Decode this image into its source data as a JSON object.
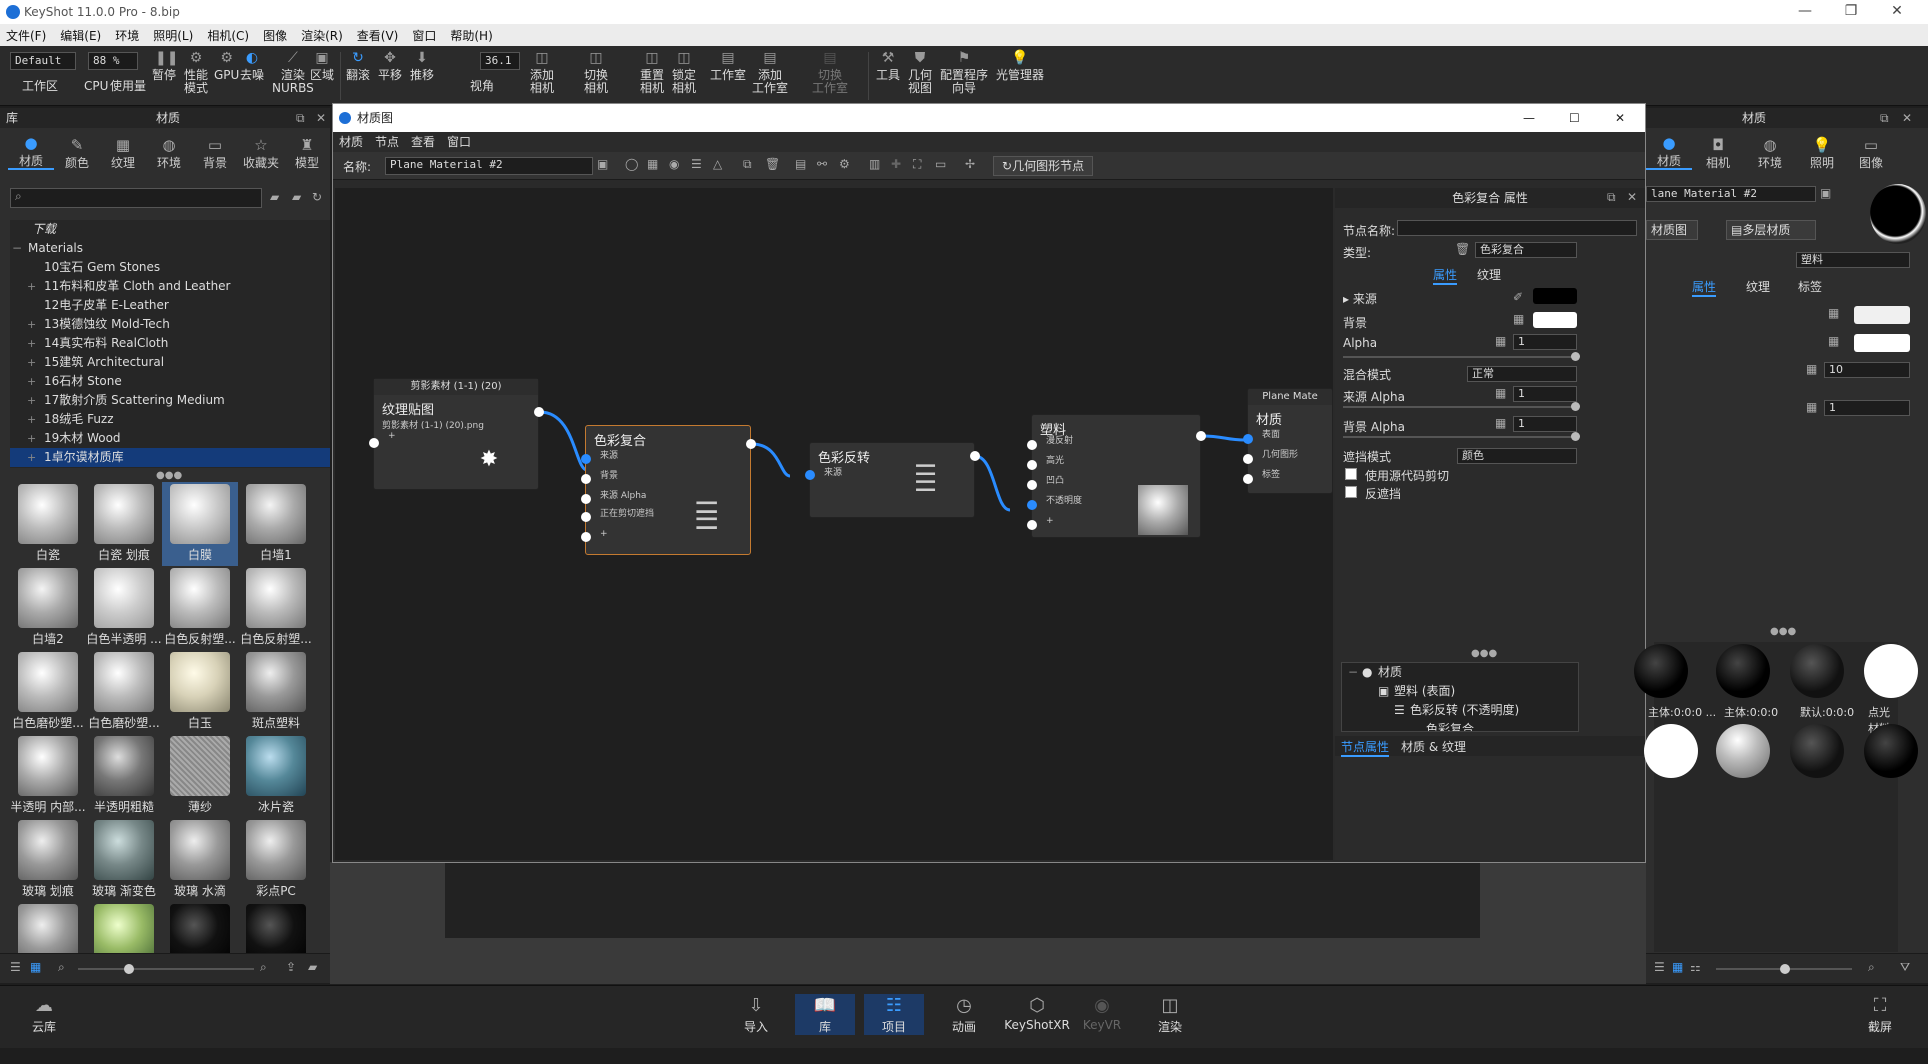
{
  "app": {
    "title": "KeyShot 11.0.0 Pro  - 8.bip",
    "minimize": "—",
    "maximize": "❐",
    "close": "✕"
  },
  "menu": [
    "文件(F)",
    "编辑(E)",
    "环境",
    "照明(L)",
    "相机(C)",
    "图像",
    "渲染(R)",
    "查看(V)",
    "窗口",
    "帮助(H)"
  ],
  "toolbar": {
    "workspace_select": "Default",
    "zoom_select": "88 %",
    "fov_value": "36.1",
    "items": [
      {
        "label": "工作区",
        "icon": "layout-icon"
      },
      {
        "label": "CPU",
        "icon": "cpu-icon"
      },
      {
        "label": "使用量",
        "icon": "usage-icon"
      },
      {
        "label": "暂停",
        "icon": "pause-icon"
      },
      {
        "label": "性能\n模式",
        "icon": "performance-icon"
      },
      {
        "label": "GPU",
        "icon": "gpu-icon"
      },
      {
        "label": "去噪",
        "icon": "denoise-icon"
      },
      {
        "label": "渲染\nNURBS",
        "icon": "nurbs-icon"
      },
      {
        "label": "区域",
        "icon": "region-icon"
      },
      {
        "label": "翻滚",
        "icon": "tumble-icon"
      },
      {
        "label": "平移",
        "icon": "pan-icon"
      },
      {
        "label": "推移",
        "icon": "dolly-icon"
      },
      {
        "label": "视角",
        "icon": "fov-icon"
      },
      {
        "label": "添加\n相机",
        "icon": "add-camera-icon"
      },
      {
        "label": "切换\n相机",
        "icon": "switch-camera-icon"
      },
      {
        "label": "重置\n相机",
        "icon": "reset-camera-icon"
      },
      {
        "label": "锁定\n相机",
        "icon": "lock-camera-icon"
      },
      {
        "label": "工作室",
        "icon": "studio-icon"
      },
      {
        "label": "添加\n工作室",
        "icon": "add-studio-icon"
      },
      {
        "label": "切换\n工作室",
        "icon": "switch-studio-icon"
      },
      {
        "label": "工具",
        "icon": "tools-icon"
      },
      {
        "label": "几何\n视图",
        "icon": "geometry-view-icon"
      },
      {
        "label": "配置程序\n向导",
        "icon": "configurator-icon"
      },
      {
        "label": "光管理器",
        "icon": "light-manager-icon"
      }
    ]
  },
  "library": {
    "header_left": "库",
    "header": "材质",
    "tabs": [
      "材质",
      "颜色",
      "纹理",
      "环境",
      "背景",
      "收藏夹",
      "模型"
    ],
    "tree": [
      "下载",
      "Materials",
      "10宝石 Gem Stones",
      "11布料和皮革 Cloth and Leather",
      "12电子皮革 E-Leather",
      "13模德蚀纹 Mold-Tech",
      "14真实布料 RealCloth",
      "15建筑 Architectural",
      "16石材 Stone",
      "17散射介质 Scattering Medium",
      "18绒毛 Fuzz",
      "19木材 Wood",
      "1卓尔谟材质库"
    ],
    "thumbs": [
      "白瓷",
      "白瓷 划痕",
      "白膜",
      "白墙1",
      "白墙2",
      "白色半透明 ...",
      "白色反射塑...",
      "白色反射塑...",
      "白色磨砂塑...",
      "白色磨砂塑...",
      "白玉",
      "斑点塑料",
      "半透明 内部...",
      "半透明粗糙",
      "薄纱",
      "冰片瓷",
      "玻璃 划痕",
      "玻璃 渐变色",
      "玻璃 水滴",
      "彩点PC",
      "",
      "",
      "",
      ""
    ]
  },
  "graph": {
    "title": "材质图",
    "menu": [
      "材质",
      "节点",
      "查看",
      "窗口"
    ],
    "name_label": "名称:",
    "name_value": "Plane Material  #2",
    "geom_button": "几何图形节点",
    "nodes": {
      "tex": {
        "header": "剪影素材 (1-1) (20)",
        "title": "纹理贴图",
        "sub": "剪影素材 (1-1) (20).png",
        "plus": "+"
      },
      "comp": {
        "title": "色彩复合",
        "ports": [
          "来源",
          "背景",
          "来源 Alpha",
          "正在剪切遮挡",
          "+"
        ]
      },
      "inv": {
        "title": "色彩反转",
        "ports": [
          "来源"
        ]
      },
      "plastic": {
        "title": "塑料",
        "ports": [
          "漫反射",
          "高光",
          "凹凸",
          "不透明度",
          "+"
        ]
      },
      "mat": {
        "header": "Plane Mate",
        "title": "材质",
        "ports": [
          "表面",
          "几何图形",
          "标签"
        ]
      }
    },
    "props": {
      "header": "色彩复合 属性",
      "node_name_label": "节点名称:",
      "type_label": "类型:",
      "type_value": "色彩复合",
      "tab_props": "属性",
      "tab_tex": "纹理",
      "source": "来源",
      "background": "背景",
      "alpha": "Alpha",
      "alpha_value": "1",
      "blend_label": "混合模式",
      "blend_value": "正常",
      "src_alpha": "来源 Alpha",
      "src_alpha_value": "1",
      "bg_alpha": "背景 Alpha",
      "bg_alpha_value": "1",
      "mask_label": "遮挡模式",
      "mask_value": "颜色",
      "use_clip": "使用源代码剪切",
      "invert": "反遮挡",
      "tree": [
        "材质",
        "塑料 (表面)",
        "色彩反转 (不透明度)",
        "色彩复合 ..."
      ],
      "bottom_tab1": "节点属性",
      "bottom_tab2": "材质 & 纹理"
    }
  },
  "right": {
    "header": "材质",
    "tabs": [
      "材质",
      "相机",
      "环境",
      "照明",
      "图像"
    ],
    "name_value": "lane Material  #2",
    "graph_btn": "材质图",
    "multi_btn": "多层材质",
    "type_value": "塑料",
    "tab_props": "属性",
    "tab_tex": "纹理",
    "tab_label": "标签",
    "val10": "10",
    "val1": "1",
    "balls": [
      "主体:0:0:0 ...",
      "主体:0:0:0",
      "默认:0:0:0",
      "点光材料 1"
    ]
  },
  "bottom": [
    {
      "label": "云库",
      "icon": "cloud-icon"
    },
    {
      "label": "导入",
      "icon": "import-icon"
    },
    {
      "label": "库",
      "icon": "library-icon"
    },
    {
      "label": "项目",
      "icon": "project-icon"
    },
    {
      "label": "动画",
      "icon": "animation-icon"
    },
    {
      "label": "KeyShotXR",
      "icon": "xr-icon"
    },
    {
      "label": "KeyVR",
      "icon": "vr-icon"
    },
    {
      "label": "渲染",
      "icon": "render-icon"
    },
    {
      "label": "截屏",
      "icon": "screenshot-icon"
    }
  ]
}
